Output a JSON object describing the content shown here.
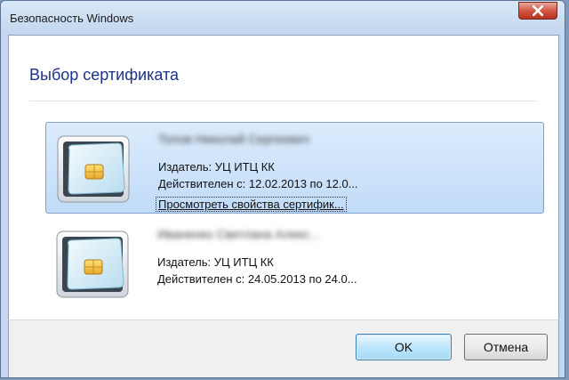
{
  "window": {
    "title": "Безопасность Windows"
  },
  "dialog": {
    "heading": "Выбор сертификата"
  },
  "certificates": [
    {
      "name": "Топов Николай Сергеевич",
      "issuer": "Издатель: УЦ ИТЦ КК",
      "valid": "Действителен с: 12.02.2013 по 12.0...",
      "link": "Просмотреть свойства сертифик...",
      "selected": true
    },
    {
      "name": "Иваненко Светлана Алекс...",
      "issuer": "Издатель: УЦ ИТЦ КК",
      "valid": "Действителен с: 24.05.2013 по 24.0...",
      "selected": false
    }
  ],
  "buttons": {
    "ok": "OK",
    "cancel": "Отмена"
  },
  "colors": {
    "heading": "#1e3287",
    "selection": "#c1dcf8",
    "close": "#c4412c"
  },
  "icons": {
    "close": "close-icon",
    "certificate": "smartcard-icon"
  }
}
